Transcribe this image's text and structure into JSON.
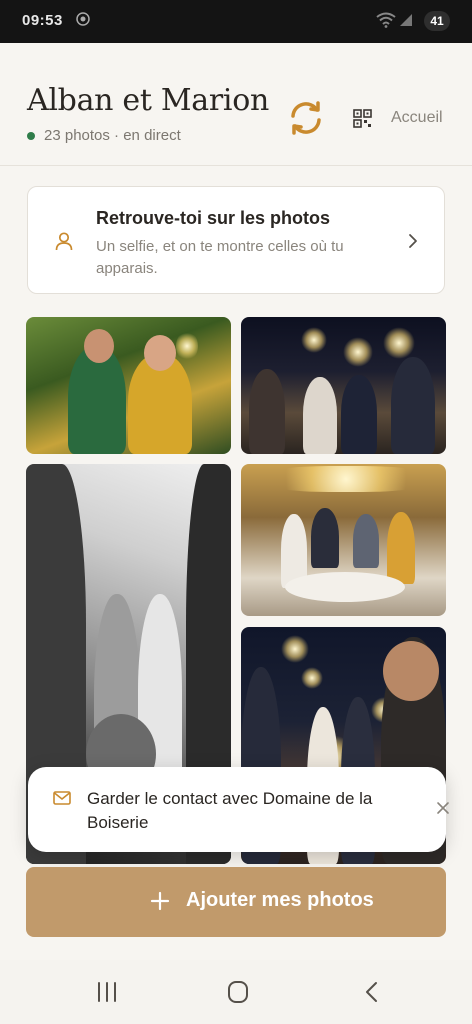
{
  "status_bar": {
    "time": "09:53",
    "battery": "41"
  },
  "header": {
    "title": "Alban et Marion",
    "subtitle": "23 photos · en direct",
    "accueil_label": "Accueil",
    "live_color": "#2f7d4a",
    "accent_color": "#c98a2e"
  },
  "find_card": {
    "title": "Retrouve-toi sur les photos",
    "description": "Un selfie, et on te montre celles où tu apparais.",
    "icon": "person-icon"
  },
  "photos": [
    {
      "name": "photo-friends-garden"
    },
    {
      "name": "photo-sparklers-couple"
    },
    {
      "name": "photo-bride-dressing-bw"
    },
    {
      "name": "photo-reception-tent"
    },
    {
      "name": "photo-sparklers-crowd"
    }
  ],
  "toast": {
    "text": "Garder le contact avec Domaine de la Boiserie",
    "icon": "mail-icon"
  },
  "add_button": {
    "label": "Ajouter mes photos",
    "color": "#c19a6b"
  },
  "nav": {
    "icons": [
      "recent-apps-icon",
      "home-icon",
      "back-icon"
    ]
  }
}
